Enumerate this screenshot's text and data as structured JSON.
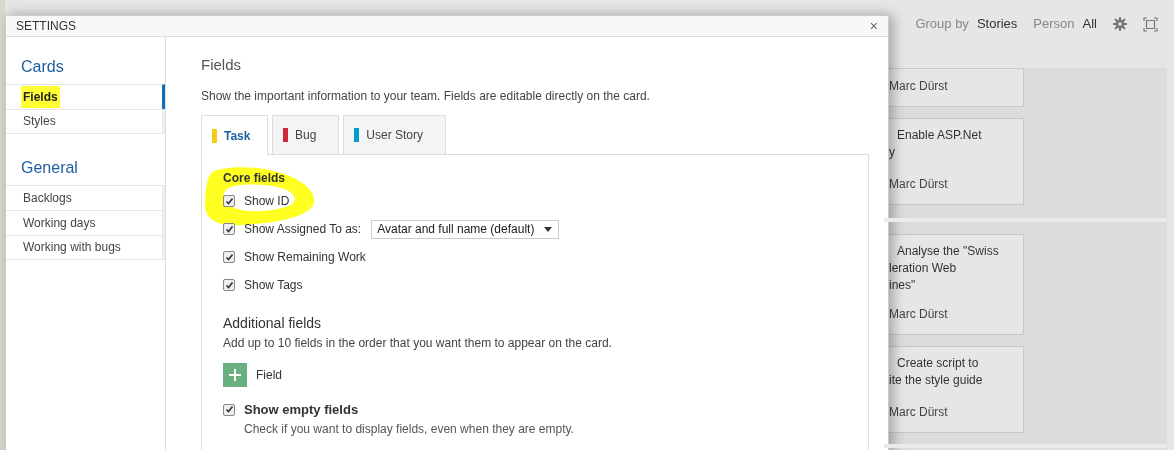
{
  "board": {
    "group_by_label": "Group by",
    "group_by_value": "Stories",
    "person_label": "Person",
    "person_value": "All",
    "cards": [
      {
        "assignee": "Marc Dürst"
      },
      {
        "lines": [
          "Enable ASP.Net",
          "y"
        ],
        "assignee": "Marc Dürst"
      },
      {
        "lines": [
          "Analyse the \"Swiss",
          "leration Web",
          "ines\""
        ],
        "assignee": "Marc Dürst"
      },
      {
        "lines": [
          "Create script to",
          "ite the style guide"
        ],
        "assignee": "Marc Dürst"
      }
    ]
  },
  "dialog": {
    "title": "SETTINGS",
    "close": "×",
    "sidebar": [
      {
        "heading": "Cards",
        "items": [
          {
            "label": "Fields",
            "selected": true,
            "highlighted": true
          },
          {
            "label": "Styles",
            "selected": false,
            "highlighted": false
          }
        ]
      },
      {
        "heading": "General",
        "items": [
          {
            "label": "Backlogs",
            "selected": false,
            "highlighted": false
          },
          {
            "label": "Working days",
            "selected": false,
            "highlighted": false
          },
          {
            "label": "Working with bugs",
            "selected": false,
            "highlighted": false
          }
        ]
      }
    ],
    "page_title": "Fields",
    "description": "Show the important information to your team. Fields are editable directly on the card.",
    "tabs": [
      {
        "label": "Task",
        "selected": true,
        "color": "#f2cb1d"
      },
      {
        "label": "Bug",
        "selected": false,
        "color": "#cc293d"
      },
      {
        "label": "User Story",
        "selected": false,
        "color": "#009ccc"
      }
    ],
    "core_fields": {
      "heading": "Core fields",
      "circled": true,
      "items": [
        {
          "label": "Show ID",
          "checked": true
        },
        {
          "label": "Show Assigned To as:",
          "checked": true,
          "dropdown": "Avatar and full name (default)"
        },
        {
          "label": "Show Remaining Work",
          "checked": true
        },
        {
          "label": "Show Tags",
          "checked": true
        }
      ]
    },
    "additional_fields": {
      "heading": "Additional fields",
      "description": "Add up to 10 fields in the order that you want them to appear on the card.",
      "add_button": "Field"
    },
    "empty_fields": {
      "label": "Show empty fields",
      "checked": true,
      "description": "Check if you want to display fields, even when they are empty."
    }
  }
}
